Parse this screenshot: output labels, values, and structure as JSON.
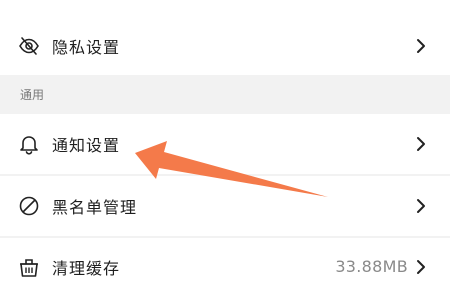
{
  "settings": {
    "privacy": {
      "label": "隐私设置",
      "icon": "eye-slash-icon"
    },
    "section_general": "通用",
    "notification": {
      "label": "通知设置",
      "icon": "bell-icon"
    },
    "blacklist": {
      "label": "黑名单管理",
      "icon": "ban-icon"
    },
    "cache": {
      "label": "清理缓存",
      "value": "33.88MB",
      "icon": "trash-icon"
    }
  },
  "colors": {
    "annotation_arrow": "#f47a4a",
    "page_background": "#f2f2f2",
    "row_background": "#ffffff"
  }
}
